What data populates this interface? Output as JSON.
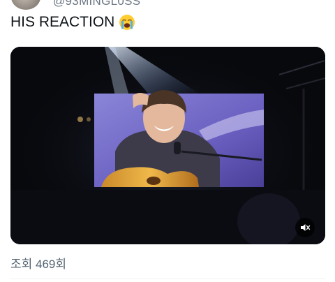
{
  "author": {
    "handle": "@93MINGL0SS",
    "avatar_icon": "profile-avatar"
  },
  "tweet": {
    "text": "HIS REACTION",
    "emoji_icon": "loudly-crying-face-emoji"
  },
  "media": {
    "type": "video",
    "mute_icon": "speaker-muted-icon",
    "muted": true
  },
  "stats": {
    "views": "조회 469회"
  },
  "colors": {
    "text_primary": "#0f1419",
    "text_secondary": "#536471",
    "video_background": "#08090d",
    "screen_accent": "#6a5fc0"
  }
}
